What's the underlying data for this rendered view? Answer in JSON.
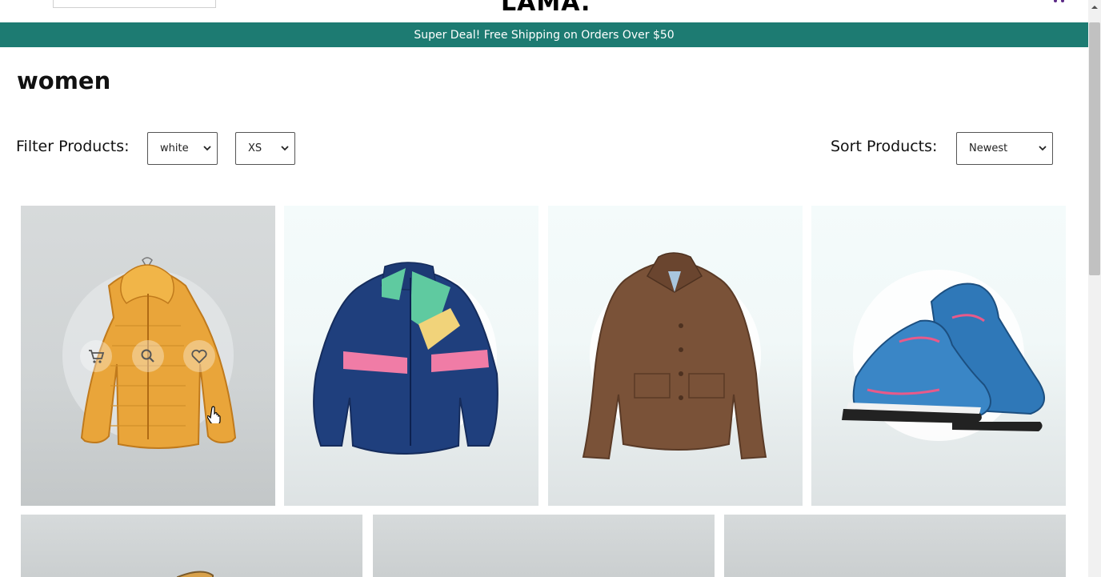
{
  "site": {
    "logo": "LAMA."
  },
  "announcement": {
    "text": "Super Deal! Free Shipping on Orders Over $50"
  },
  "page": {
    "title": "women"
  },
  "filters": {
    "label": "Filter Products:",
    "color_selected": "white",
    "size_selected": "XS"
  },
  "sort": {
    "label": "Sort Products:",
    "selected": "Newest"
  },
  "products": [
    {
      "name": "orange puffer jacket",
      "hovered": true
    },
    {
      "name": "colorblock windbreaker jacket",
      "hovered": false
    },
    {
      "name": "brown jacket",
      "hovered": false
    },
    {
      "name": "blue running sneakers",
      "hovered": false
    }
  ],
  "product_actions": [
    "cart-icon",
    "search-icon",
    "heart-icon"
  ],
  "colors": {
    "announcement_bg": "#1d7b72",
    "accent": "#5b2a86"
  }
}
